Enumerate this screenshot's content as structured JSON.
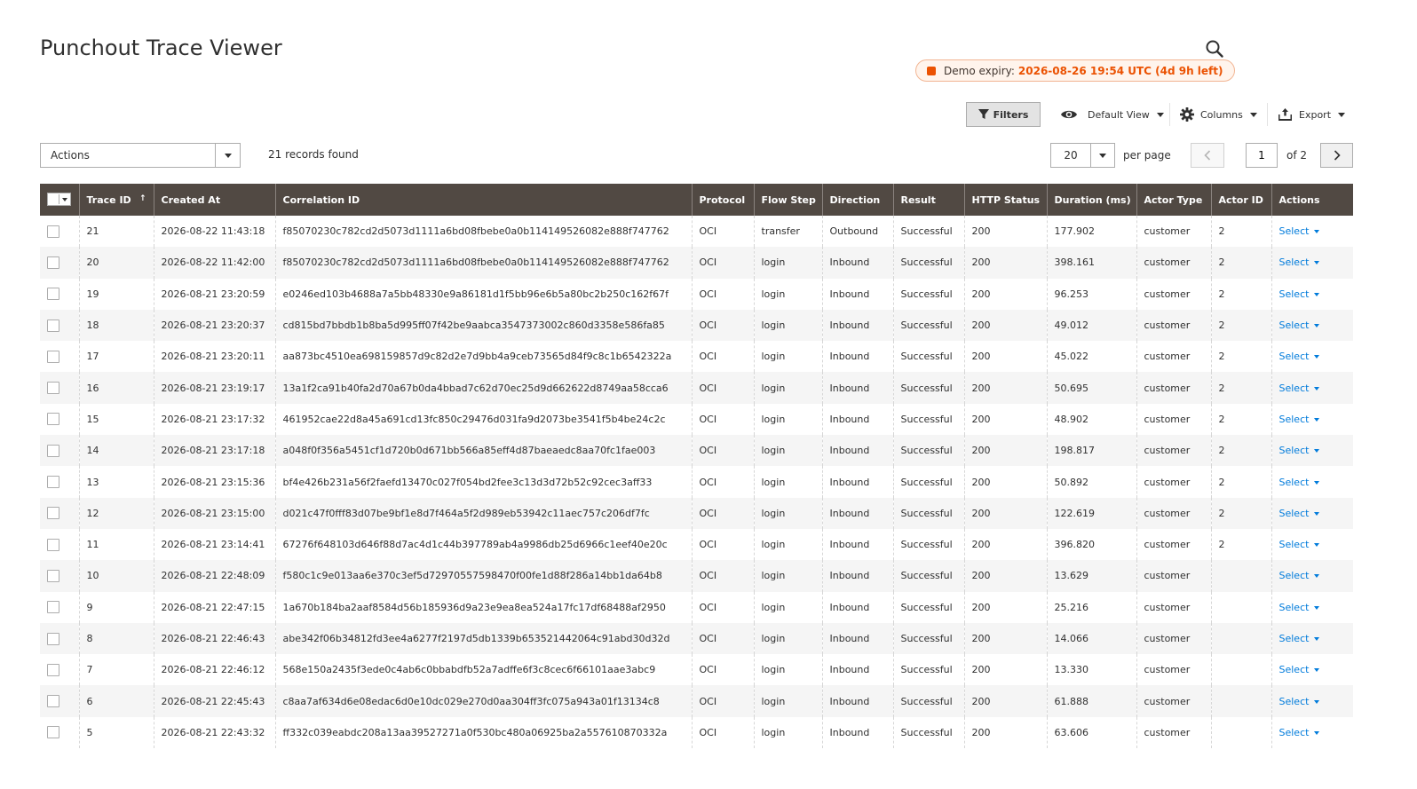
{
  "page": {
    "title": "Punchout Trace Viewer"
  },
  "demo_badge": {
    "label": "Demo expiry:",
    "value": "2026-08-26 19:54 UTC (4d 9h left)"
  },
  "toolbar": {
    "filters_label": "Filters",
    "view_label": "Default View",
    "columns_label": "Columns",
    "export_label": "Export"
  },
  "mass_actions": {
    "label": "Actions"
  },
  "records_found": "21 records found",
  "pagination": {
    "per_page_value": "20",
    "per_page_label": "per page",
    "current_page": "1",
    "of_label": "of 2"
  },
  "columns": [
    "Trace ID",
    "Created At",
    "Correlation ID",
    "Protocol",
    "Flow Step",
    "Direction",
    "Result",
    "HTTP Status",
    "Duration (ms)",
    "Actor Type",
    "Actor ID",
    "Actions"
  ],
  "rows": [
    {
      "id": "21",
      "created": "2026-08-22 11:43:18",
      "corr": "f85070230c782cd2d5073d1111a6bd08fbebe0a0b114149526082e888f747762",
      "protocol": "OCI",
      "step": "transfer",
      "direction": "Outbound",
      "result": "Successful",
      "http": "200",
      "duration": "177.902",
      "actor_type": "customer",
      "actor_id": "2",
      "action": "Select"
    },
    {
      "id": "20",
      "created": "2026-08-22 11:42:00",
      "corr": "f85070230c782cd2d5073d1111a6bd08fbebe0a0b114149526082e888f747762",
      "protocol": "OCI",
      "step": "login",
      "direction": "Inbound",
      "result": "Successful",
      "http": "200",
      "duration": "398.161",
      "actor_type": "customer",
      "actor_id": "2",
      "action": "Select"
    },
    {
      "id": "19",
      "created": "2026-08-21 23:20:59",
      "corr": "e0246ed103b4688a7a5bb48330e9a86181d1f5bb96e6b5a80bc2b250c162f67f",
      "protocol": "OCI",
      "step": "login",
      "direction": "Inbound",
      "result": "Successful",
      "http": "200",
      "duration": "96.253",
      "actor_type": "customer",
      "actor_id": "2",
      "action": "Select"
    },
    {
      "id": "18",
      "created": "2026-08-21 23:20:37",
      "corr": "cd815bd7bbdb1b8ba5d995ff07f42be9aabca3547373002c860d3358e586fa85",
      "protocol": "OCI",
      "step": "login",
      "direction": "Inbound",
      "result": "Successful",
      "http": "200",
      "duration": "49.012",
      "actor_type": "customer",
      "actor_id": "2",
      "action": "Select"
    },
    {
      "id": "17",
      "created": "2026-08-21 23:20:11",
      "corr": "aa873bc4510ea698159857d9c82d2e7d9bb4a9ceb73565d84f9c8c1b6542322a",
      "protocol": "OCI",
      "step": "login",
      "direction": "Inbound",
      "result": "Successful",
      "http": "200",
      "duration": "45.022",
      "actor_type": "customer",
      "actor_id": "2",
      "action": "Select"
    },
    {
      "id": "16",
      "created": "2026-08-21 23:19:17",
      "corr": "13a1f2ca91b40fa2d70a67b0da4bbad7c62d70ec25d9d662622d8749aa58cca6",
      "protocol": "OCI",
      "step": "login",
      "direction": "Inbound",
      "result": "Successful",
      "http": "200",
      "duration": "50.695",
      "actor_type": "customer",
      "actor_id": "2",
      "action": "Select"
    },
    {
      "id": "15",
      "created": "2026-08-21 23:17:32",
      "corr": "461952cae22d8a45a691cd13fc850c29476d031fa9d2073be3541f5b4be24c2c",
      "protocol": "OCI",
      "step": "login",
      "direction": "Inbound",
      "result": "Successful",
      "http": "200",
      "duration": "48.902",
      "actor_type": "customer",
      "actor_id": "2",
      "action": "Select"
    },
    {
      "id": "14",
      "created": "2026-08-21 23:17:18",
      "corr": "a048f0f356a5451cf1d720b0d671bb566a85eff4d87baeaedc8aa70fc1fae003",
      "protocol": "OCI",
      "step": "login",
      "direction": "Inbound",
      "result": "Successful",
      "http": "200",
      "duration": "198.817",
      "actor_type": "customer",
      "actor_id": "2",
      "action": "Select"
    },
    {
      "id": "13",
      "created": "2026-08-21 23:15:36",
      "corr": "bf4e426b231a56f2faefd13470c027f054bd2fee3c13d3d72b52c92cec3aff33",
      "protocol": "OCI",
      "step": "login",
      "direction": "Inbound",
      "result": "Successful",
      "http": "200",
      "duration": "50.892",
      "actor_type": "customer",
      "actor_id": "2",
      "action": "Select"
    },
    {
      "id": "12",
      "created": "2026-08-21 23:15:00",
      "corr": "d021c47f0fff83d07be9bf1e8d7f464a5f2d989eb53942c11aec757c206df7fc",
      "protocol": "OCI",
      "step": "login",
      "direction": "Inbound",
      "result": "Successful",
      "http": "200",
      "duration": "122.619",
      "actor_type": "customer",
      "actor_id": "2",
      "action": "Select"
    },
    {
      "id": "11",
      "created": "2026-08-21 23:14:41",
      "corr": "67276f648103d646f88d7ac4d1c44b397789ab4a9986db25d6966c1eef40e20c",
      "protocol": "OCI",
      "step": "login",
      "direction": "Inbound",
      "result": "Successful",
      "http": "200",
      "duration": "396.820",
      "actor_type": "customer",
      "actor_id": "2",
      "action": "Select"
    },
    {
      "id": "10",
      "created": "2026-08-21 22:48:09",
      "corr": "f580c1c9e013aa6e370c3ef5d72970557598470f00fe1d88f286a14bb1da64b8",
      "protocol": "OCI",
      "step": "login",
      "direction": "Inbound",
      "result": "Successful",
      "http": "200",
      "duration": "13.629",
      "actor_type": "customer",
      "actor_id": "",
      "action": "Select"
    },
    {
      "id": "9",
      "created": "2026-08-21 22:47:15",
      "corr": "1a670b184ba2aaf8584d56b185936d9a23e9ea8ea524a17fc17df68488af2950",
      "protocol": "OCI",
      "step": "login",
      "direction": "Inbound",
      "result": "Successful",
      "http": "200",
      "duration": "25.216",
      "actor_type": "customer",
      "actor_id": "",
      "action": "Select"
    },
    {
      "id": "8",
      "created": "2026-08-21 22:46:43",
      "corr": "abe342f06b34812fd3ee4a6277f2197d5db1339b653521442064c91abd30d32d",
      "protocol": "OCI",
      "step": "login",
      "direction": "Inbound",
      "result": "Successful",
      "http": "200",
      "duration": "14.066",
      "actor_type": "customer",
      "actor_id": "",
      "action": "Select"
    },
    {
      "id": "7",
      "created": "2026-08-21 22:46:12",
      "corr": "568e150a2435f3ede0c4ab6c0bbabdfb52a7adffe6f3c8cec6f66101aae3abc9",
      "protocol": "OCI",
      "step": "login",
      "direction": "Inbound",
      "result": "Successful",
      "http": "200",
      "duration": "13.330",
      "actor_type": "customer",
      "actor_id": "",
      "action": "Select"
    },
    {
      "id": "6",
      "created": "2026-08-21 22:45:43",
      "corr": "c8aa7af634d6e08edac6d0e10dc029e270d0aa304ff3fc075a943a01f13134c8",
      "protocol": "OCI",
      "step": "login",
      "direction": "Inbound",
      "result": "Successful",
      "http": "200",
      "duration": "61.888",
      "actor_type": "customer",
      "actor_id": "",
      "action": "Select"
    },
    {
      "id": "5",
      "created": "2026-08-21 22:43:32",
      "corr": "ff332c039eabdc208a13aa39527271a0f530bc480a06925ba2a557610870332a",
      "protocol": "OCI",
      "step": "login",
      "direction": "Inbound",
      "result": "Successful",
      "http": "200",
      "duration": "63.606",
      "actor_type": "customer",
      "actor_id": "",
      "action": "Select"
    }
  ]
}
